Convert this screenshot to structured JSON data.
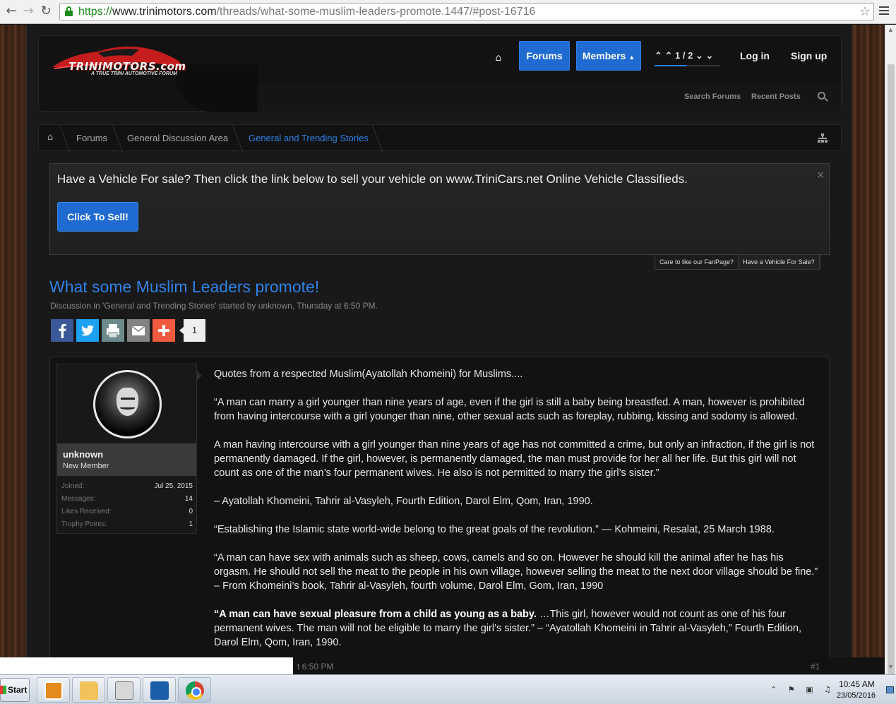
{
  "browser": {
    "url_proto": "https://",
    "url_host": "www.trinimotors.com",
    "url_path": "/threads/what-some-muslim-leaders-promote.1447/#post-16716"
  },
  "header": {
    "logo_text": "TRINIMOTORS.com",
    "logo_sub": "A TRUE TRINI AUTOMOTIVE FORUM",
    "nav": {
      "forums": "Forums",
      "members": "Members",
      "pager": "1 / 2",
      "login": "Log in",
      "signup": "Sign up"
    },
    "sub": {
      "search_forums": "Search Forums",
      "recent_posts": "Recent Posts"
    }
  },
  "breadcrumb": {
    "items": [
      "Forums",
      "General Discussion Area",
      "General and Trending Stories"
    ]
  },
  "notice": {
    "text": "Have a Vehicle For sale? Then click the link below to sell your vehicle on www.TriniCars.net Online Vehicle Classifieds.",
    "button": "Click To Sell!",
    "close": "×",
    "tabs": [
      "Care to like our FanPage?",
      "Have a Vehicle For Sale?"
    ]
  },
  "thread": {
    "title": "What some Muslim Leaders promote!",
    "meta": "Discussion in 'General and Trending Stories' started by unknown, Thursday at 6:50 PM.",
    "share_count": "1"
  },
  "post": {
    "username": "unknown",
    "user_title": "New Member",
    "stats": [
      {
        "label": "Joined:",
        "value": "Jul 25, 2015"
      },
      {
        "label": "Messages:",
        "value": "14"
      },
      {
        "label": "Likes Received:",
        "value": "0"
      },
      {
        "label": "Trophy Points:",
        "value": "1"
      }
    ],
    "paragraphs": [
      "Quotes from a respected Muslim(Ayatollah Khomeini) for Muslims....",
      "“A man can marry a girl younger than nine years of age, even if the girl is still a baby being breastfed. A man, however is prohibited from having intercourse with a girl younger than nine, other sexual acts such as foreplay, rubbing, kissing and sodomy is allowed.",
      "A man having intercourse with a girl younger than nine years of age has not committed a crime, but only an infraction, if the girl is not permanently damaged. If the girl, however, is permanently damaged, the man must provide for her all her life. But this girl will not count as one of the man’s four permanent wives. He also is not permitted to marry the girl’s sister.”",
      "– Ayatollah Khomeini, Tahrir al-Vasyleh, Fourth Edition, Darol Elm, Qom, Iran, 1990.",
      "“Establishing the Islamic state world-wide belong to the great goals of the revolution.” — Kohmeini, Resalat, 25 March 1988.",
      "“A man can have sex with animals such as sheep, cows, camels and so on. However he should kill the animal after he has his orgasm. He should not sell the meat to the people in his own village, however selling the meat to the next door village should be fine.” – From Khomeini’s book, Tahrir al-Vasyleh, fourth volume, Darol Elm, Gom, Iran, 1990"
    ],
    "last_bold": "“A man can have sexual pleasure from a child as young as a baby.",
    "last_rest": " …This girl, however would not count as one of his four permanent wives. The man will not be eligible to marry the girl’s sister.” – “Ayatollah Khomeini in Tahrir al-Vasyleh,” Fourth Edition, Darol Elm, Qom, Iran, 1990.",
    "footer_time": "t 6:50 PM",
    "post_number": "#1"
  },
  "taskbar": {
    "start": "Start",
    "time": "10:45 AM",
    "date": "23/05/2016"
  }
}
